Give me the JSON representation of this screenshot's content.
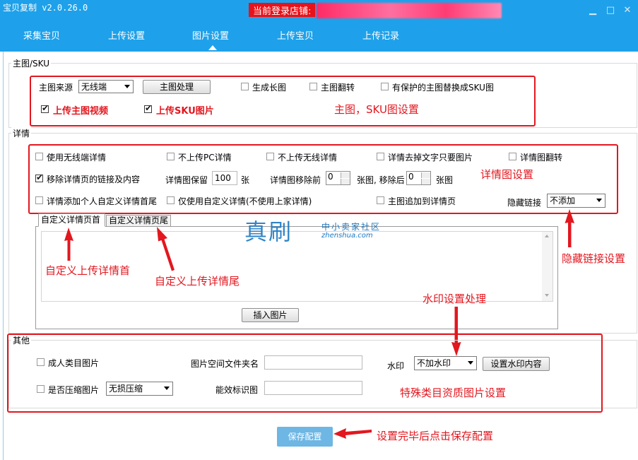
{
  "app": {
    "title": "宝贝复制 v2.0.26.0",
    "login_label": "当前登录店铺:",
    "window_buttons": [
      "minimize-icon",
      "maximize-icon",
      "close-icon"
    ]
  },
  "nav": {
    "tabs": [
      "采集宝贝",
      "上传设置",
      "图片设置",
      "上传宝贝",
      "上传记录"
    ],
    "active": "图片设置"
  },
  "main_sku": {
    "legend": "主图/SKU",
    "source_label": "主图来源",
    "source_value": "无线端",
    "process_button": "主图处理",
    "gen_long": "生成长图",
    "flip": "主图翻转",
    "replace_protected": "有保护的主图替换成SKU图",
    "upload_video": "上传主图视频",
    "upload_sku": "上传SKU图片",
    "annotation": "主图，SKU图设置"
  },
  "detail": {
    "legend": "详情",
    "use_mobile": "使用无线端详情",
    "no_pc": "不上传PC详情",
    "no_mobile": "不上传无线详情",
    "remove_text": "详情去掉文字只要图片",
    "flip": "详情图翻转",
    "remove_links": "移除详情页的链接及内容",
    "keep_label": "详情图保留",
    "keep_value": "100",
    "keep_unit": "张",
    "remove_before_label": "详情图移除前",
    "remove_before_value": "0",
    "remove_after_label": "张图, 移除后",
    "remove_after_value": "0",
    "remove_after_unit": "张图",
    "add_custom_head": "详情添加个人自定义详情首尾",
    "only_custom": "仅使用自定义详情(不使用上家详情)",
    "append_main": "主图追加到详情页",
    "hide_links_label": "隐藏链接",
    "hide_links_value": "不添加",
    "annotation": "详情图设置",
    "subtab_head": "自定义详情页首",
    "subtab_tail": "自定义详情页尾",
    "insert_button": "插入图片",
    "anno_head": "自定义上传详情首",
    "anno_tail": "自定义上传详情尾",
    "anno_hide": "隐藏链接设置"
  },
  "watermark_logo": {
    "main": "真刷",
    "sub": "中小卖家社区",
    "url": "zhenshua.com"
  },
  "other": {
    "legend": "其他",
    "adult": "成人类目图片",
    "compress": "是否压缩图片",
    "compress_value": "无损压缩",
    "folder_label": "图片空间文件夹名",
    "energy_label": "能效标识图",
    "watermark_label": "水印",
    "watermark_value": "不加水印",
    "watermark_button": "设置水印内容",
    "anno_watermark": "水印设置处理",
    "anno_special": "特殊类目资质图片设置"
  },
  "footer": {
    "save_button": "保存配置",
    "annotation": "设置完毕后点击保存配置"
  },
  "colors": {
    "titlebar": "#1ea1ea",
    "annotation": "#e2171f",
    "save_button": "#6eb6e4"
  }
}
